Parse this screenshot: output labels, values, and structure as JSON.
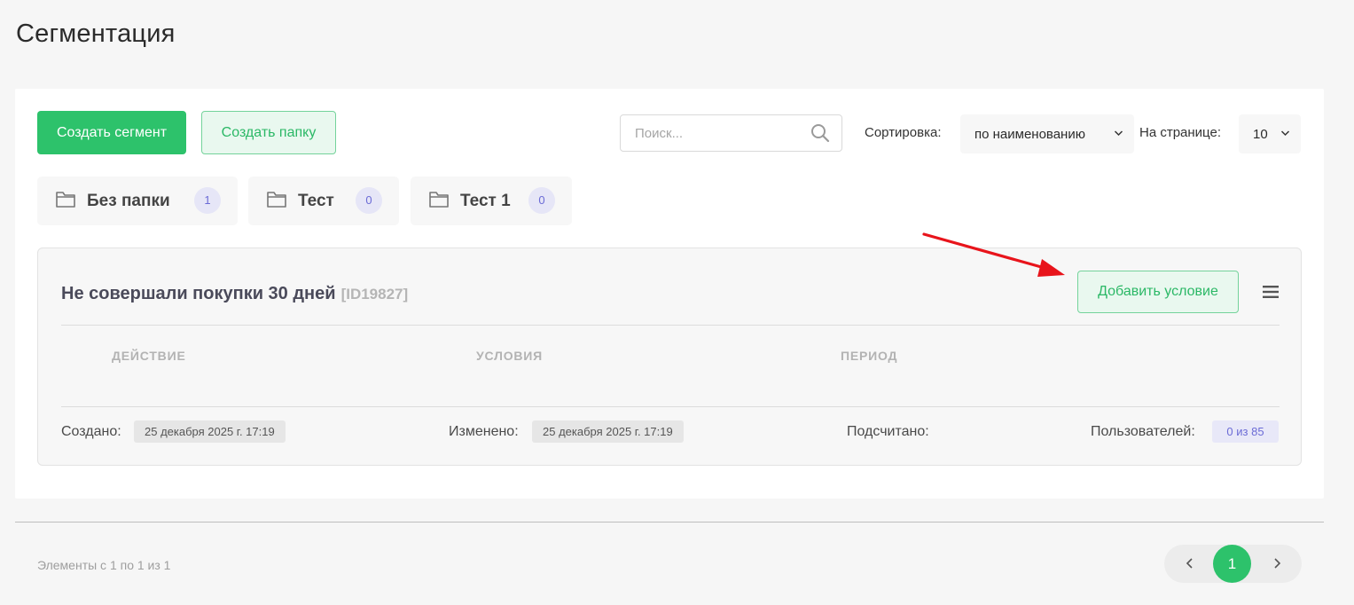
{
  "page": {
    "title": "Сегментация"
  },
  "toolbar": {
    "create_segment_label": "Создать сегмент",
    "create_folder_label": "Создать папку",
    "search_placeholder": "Поиск...",
    "search_value": "",
    "sort_label": "Сортировка:",
    "sort_value": "по наименованию",
    "per_page_label": "На странице:",
    "per_page_value": "10"
  },
  "folders": [
    {
      "name": "Без папки",
      "count": "1"
    },
    {
      "name": "Тест",
      "count": "0"
    },
    {
      "name": "Тест 1",
      "count": "0"
    }
  ],
  "segment": {
    "title": "Не совершали покупки 30 дней",
    "id": "[ID19827]",
    "add_condition_label": "Добавить условие",
    "columns": [
      "ДЕЙСТВИЕ",
      "УСЛОВИЯ",
      "ПЕРИОД"
    ],
    "created_label": "Создано:",
    "created_value": "25 декабря 2025 г. 17:19",
    "modified_label": "Изменено:",
    "modified_value": "25 декабря 2025 г. 17:19",
    "counted_label": "Подсчитано:",
    "users_label": "Пользователей:",
    "users_value": "0 из 85"
  },
  "footer": {
    "info": "Элементы с 1 по 1 из 1",
    "current_page": "1"
  },
  "colors": {
    "accent": "#2dc26b",
    "badge_purple": "#6b6bd6",
    "annotation_arrow": "#e8141b"
  },
  "icons": [
    "search-icon",
    "chevron-down-icon",
    "folder-icon",
    "menu-icon",
    "chevron-left-icon",
    "chevron-right-icon",
    "arrow-annotation"
  ]
}
